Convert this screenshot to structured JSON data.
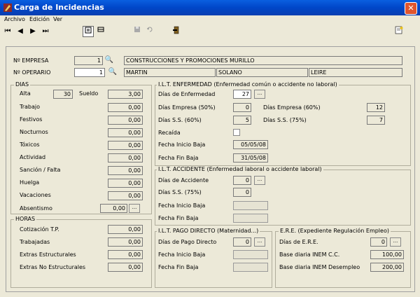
{
  "window": {
    "title": "Carga de Incidencias",
    "close_label": "✕"
  },
  "menu": [
    "Archivo",
    "Edición",
    "Ver"
  ],
  "toolbar": {
    "first": "⏮",
    "prev": "◀",
    "next": "▶",
    "last": "⏭"
  },
  "empresa": {
    "label": "Nº EMPRESA",
    "num": "1",
    "name": "CONSTRUCCIONES Y PROMOCIONES MURILLO"
  },
  "operario": {
    "label": "Nº OPERARIO",
    "num": "1",
    "nombre": "MARTIN",
    "apellido1": "SOLANO",
    "apellido2": "LEIRE"
  },
  "dias": {
    "title": "DIAS",
    "alta_label": "Alta",
    "alta_value": "30",
    "sueldo_label": "Sueldo",
    "sueldo_value": "3,00",
    "rows": [
      {
        "label": "Trabajo",
        "value": "0,00"
      },
      {
        "label": "Festivos",
        "value": "0,00"
      },
      {
        "label": "Nocturnos",
        "value": "0,00"
      },
      {
        "label": "Tóxicos",
        "value": "0,00"
      },
      {
        "label": "Actividad",
        "value": "0,00"
      },
      {
        "label": "Sanción / Falta",
        "value": "0,00"
      },
      {
        "label": "Huelga",
        "value": "0,00"
      },
      {
        "label": "Vacaciones",
        "value": "0,00"
      },
      {
        "label": "Absentismo",
        "value": "0,00"
      }
    ]
  },
  "horas": {
    "title": "HORAS",
    "rows": [
      {
        "label": "Cotización T.P.",
        "value": "0,00"
      },
      {
        "label": "Trabajadas",
        "value": "0,00"
      },
      {
        "label": "Extras Estructurales",
        "value": "0,00"
      },
      {
        "label": "Extras No Estructurales",
        "value": "0,00"
      }
    ]
  },
  "ilt_enf": {
    "title": "I.L.T. ENFERMEDAD (Enfermedad común o accidente no laboral)",
    "dias_enf_label": "Días de Enfermedad",
    "dias_enf_value": "27",
    "dias_emp50_label": "Días Empresa (50%)",
    "dias_emp50_value": "0",
    "dias_emp60_label": "Días Empresa (60%)",
    "dias_emp60_value": "12",
    "dias_ss60_label": "Días S.S. (60%)",
    "dias_ss60_value": "5",
    "dias_ss75_label": "Días S.S. (75%)",
    "dias_ss75_value": "7",
    "recaida_label": "Recaída",
    "inicio_label": "Fecha Inicio Baja",
    "inicio_value": "05/05/08",
    "fin_label": "Fecha Fin Baja",
    "fin_value": "31/05/08"
  },
  "ilt_acc": {
    "title": "I.L.T. ACCIDENTE (Enfermedad laboral o accidente laboral)",
    "dias_acc_label": "Días de Accidente",
    "dias_acc_value": "0",
    "dias_ss75_label": "Días S.S. (75%)",
    "dias_ss75_value": "0",
    "inicio_label": "Fecha Inicio Baja",
    "inicio_value": "",
    "fin_label": "Fecha Fin Baja",
    "fin_value": ""
  },
  "ilt_pago": {
    "title": "I.L.T. PAGO DIRECTO (Maternidad...)",
    "dias_label": "Días de Pago Directo",
    "dias_value": "0",
    "inicio_label": "Fecha Inicio Baja",
    "inicio_value": "",
    "fin_label": "Fecha Fin Baja",
    "fin_value": ""
  },
  "ere": {
    "title": "E.R.E. (Expediente Regulación Empleo)",
    "dias_label": "Días de E.R.E.",
    "dias_value": "0",
    "base_cc_label": "Base diaria INEM C.C.",
    "base_cc_value": "100,00",
    "base_des_label": "Base diaria INEM Desempleo",
    "base_des_value": "200,00"
  }
}
